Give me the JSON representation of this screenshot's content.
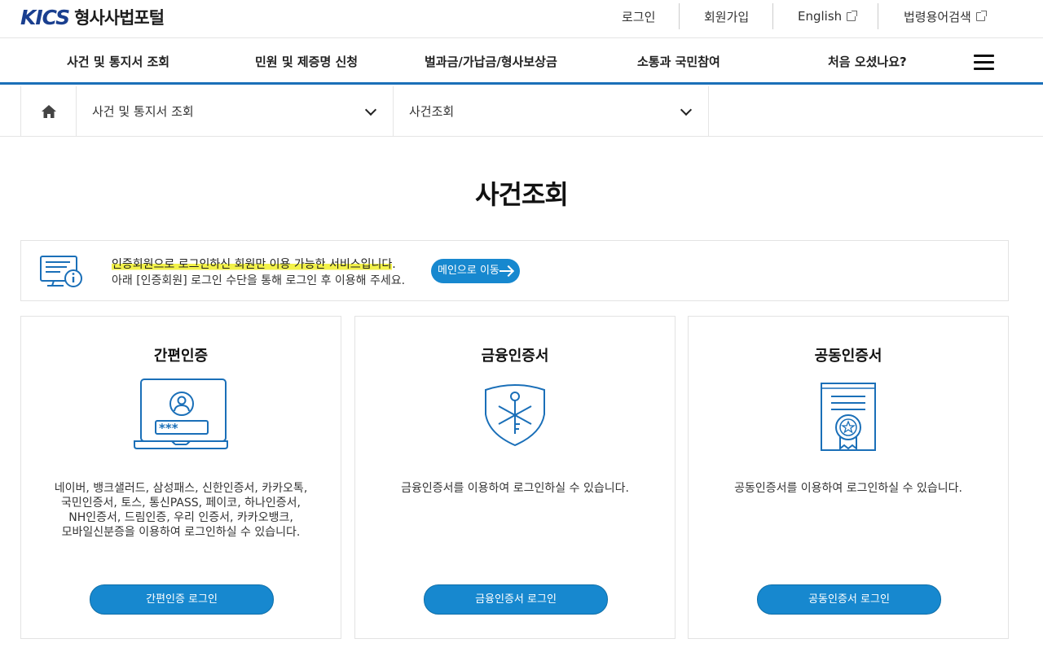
{
  "header": {
    "logo_mark": "KICS",
    "logo_text": "형사사법포털",
    "utility_links": [
      "로그인",
      "회원가입",
      "English",
      "법령용어검색"
    ]
  },
  "nav": {
    "items": [
      "사건 및 통지서 조회",
      "민원 및 제증명 신청",
      "벌과금/가납금/형사보상금",
      "소통과 국민참여",
      "처음 오셨나요?"
    ]
  },
  "breadcrumb": {
    "level1": "사건 및 통지서 조회",
    "level2": "사건조회"
  },
  "page": {
    "title": "사건조회"
  },
  "notice": {
    "highlight": "인증회원으로 로그인하신 회원만 이용 가능한 서비스입니다",
    "line1_end": ".",
    "line2": "아래 [인증회원] 로그인 수단을 통해 로그인 후 이용해 주세요.",
    "button": "메인으로 이동"
  },
  "cards": [
    {
      "title": "간편인증",
      "desc_lines": [
        "네이버, 뱅크샐러드, 삼성패스, 신한인증서, 카카오톡,",
        "국민인증서, 토스, 통신PASS, 페이코, 하나인증서,",
        "NH인증서, 드림인증, 우리 인증서, 카카오뱅크,",
        "모바일신분증을 이용하여 로그인하실 수 있습니다."
      ],
      "button": "간편인증 로그인",
      "icon": "laptop-login-icon"
    },
    {
      "title": "금융인증서",
      "desc_lines": [
        "금융인증서를 이용하여 로그인하실 수 있습니다."
      ],
      "button": "금융인증서 로그인",
      "icon": "shield-key-icon"
    },
    {
      "title": "공동인증서",
      "desc_lines": [
        "공동인증서를 이용하여 로그인하실 수 있습니다."
      ],
      "button": "공동인증서 로그인",
      "icon": "certificate-icon"
    }
  ],
  "colors": {
    "primary": "#1788cf",
    "brand": "#1a3f8f",
    "highlight": "#f3f24a"
  }
}
